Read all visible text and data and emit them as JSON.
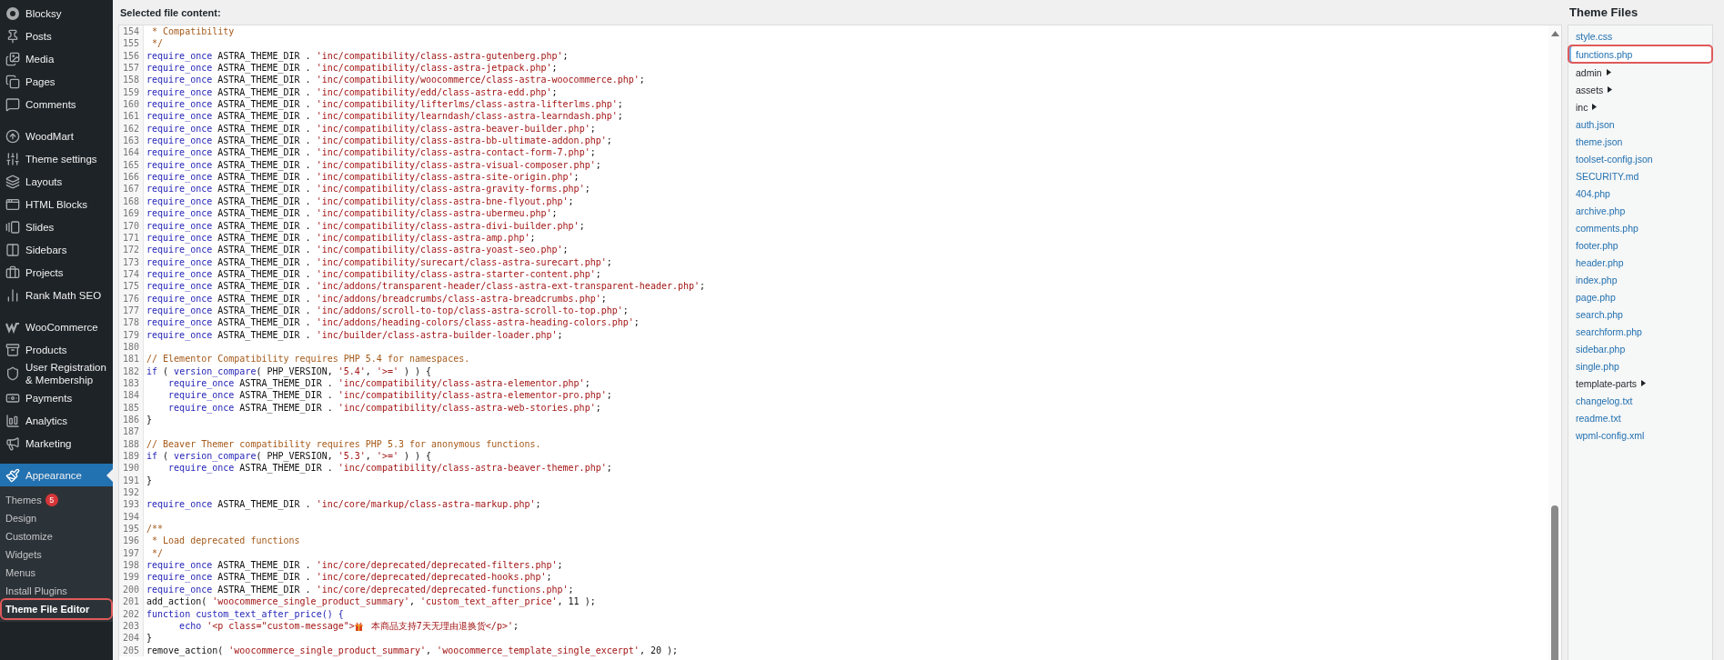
{
  "sidebar": {
    "groups": [
      {
        "items": [
          {
            "label": "Blocksy",
            "selected": false
          },
          {
            "label": "Posts",
            "selected": false
          },
          {
            "label": "Media",
            "selected": false
          },
          {
            "label": "Pages",
            "selected": false
          },
          {
            "label": "Comments",
            "selected": false
          }
        ]
      },
      {
        "items": [
          {
            "label": "WoodMart",
            "selected": false
          },
          {
            "label": "Theme settings",
            "selected": false
          },
          {
            "label": "Layouts",
            "selected": false
          },
          {
            "label": "HTML Blocks",
            "selected": false
          },
          {
            "label": "Slides",
            "selected": false
          },
          {
            "label": "Sidebars",
            "selected": false
          },
          {
            "label": "Projects",
            "selected": false
          },
          {
            "label": "Rank Math SEO",
            "selected": false
          }
        ]
      },
      {
        "items": [
          {
            "label": "WooCommerce",
            "selected": false
          },
          {
            "label": "Products",
            "selected": false
          },
          {
            "label": "User Registration & Membership",
            "selected": false
          },
          {
            "label": "Payments",
            "selected": false
          },
          {
            "label": "Analytics",
            "selected": false
          },
          {
            "label": "Marketing",
            "selected": false
          }
        ]
      },
      {
        "items": [
          {
            "label": "Appearance",
            "selected": true,
            "children": [
              {
                "label": "Themes",
                "badge": "5",
                "selected": false,
                "highlighted": false
              },
              {
                "label": "Design",
                "selected": false,
                "highlighted": false
              },
              {
                "label": "Customize",
                "selected": false,
                "highlighted": false
              },
              {
                "label": "Widgets",
                "selected": false,
                "highlighted": false
              },
              {
                "label": "Menus",
                "selected": false,
                "highlighted": false
              },
              {
                "label": "Install Plugins",
                "selected": false,
                "highlighted": false
              },
              {
                "label": "Theme File Editor",
                "selected": true,
                "highlighted": true
              }
            ]
          }
        ]
      }
    ]
  },
  "editor": {
    "heading": "Selected file content:",
    "lines": [
      {
        "number": "154",
        "tokens": [
          {
            "kind": "comment",
            "text": " * Compatibility"
          }
        ]
      },
      {
        "number": "155",
        "tokens": [
          {
            "kind": "comment",
            "text": " */"
          }
        ]
      },
      {
        "number": "156",
        "tokens": [
          {
            "kind": "keyword",
            "text": "require_once"
          },
          {
            "kind": "plain",
            "text": " ASTRA_THEME_DIR . "
          },
          {
            "kind": "string",
            "text": "'inc/compatibility/class-astra-gutenberg.php'"
          },
          {
            "kind": "plain",
            "text": ";"
          }
        ]
      },
      {
        "number": "157",
        "tokens": [
          {
            "kind": "keyword",
            "text": "require_once"
          },
          {
            "kind": "plain",
            "text": " ASTRA_THEME_DIR . "
          },
          {
            "kind": "string",
            "text": "'inc/compatibility/class-astra-jetpack.php'"
          },
          {
            "kind": "plain",
            "text": ";"
          }
        ]
      },
      {
        "number": "158",
        "tokens": [
          {
            "kind": "keyword",
            "text": "require_once"
          },
          {
            "kind": "plain",
            "text": " ASTRA_THEME_DIR . "
          },
          {
            "kind": "string",
            "text": "'inc/compatibility/woocommerce/class-astra-woocommerce.php'"
          },
          {
            "kind": "plain",
            "text": ";"
          }
        ]
      },
      {
        "number": "159",
        "tokens": [
          {
            "kind": "keyword",
            "text": "require_once"
          },
          {
            "kind": "plain",
            "text": " ASTRA_THEME_DIR . "
          },
          {
            "kind": "string",
            "text": "'inc/compatibility/edd/class-astra-edd.php'"
          },
          {
            "kind": "plain",
            "text": ";"
          }
        ]
      },
      {
        "number": "160",
        "tokens": [
          {
            "kind": "keyword",
            "text": "require_once"
          },
          {
            "kind": "plain",
            "text": " ASTRA_THEME_DIR . "
          },
          {
            "kind": "string",
            "text": "'inc/compatibility/lifterlms/class-astra-lifterlms.php'"
          },
          {
            "kind": "plain",
            "text": ";"
          }
        ]
      },
      {
        "number": "161",
        "tokens": [
          {
            "kind": "keyword",
            "text": "require_once"
          },
          {
            "kind": "plain",
            "text": " ASTRA_THEME_DIR . "
          },
          {
            "kind": "string",
            "text": "'inc/compatibility/learndash/class-astra-learndash.php'"
          },
          {
            "kind": "plain",
            "text": ";"
          }
        ]
      },
      {
        "number": "162",
        "tokens": [
          {
            "kind": "keyword",
            "text": "require_once"
          },
          {
            "kind": "plain",
            "text": " ASTRA_THEME_DIR . "
          },
          {
            "kind": "string",
            "text": "'inc/compatibility/class-astra-beaver-builder.php'"
          },
          {
            "kind": "plain",
            "text": ";"
          }
        ]
      },
      {
        "number": "163",
        "tokens": [
          {
            "kind": "keyword",
            "text": "require_once"
          },
          {
            "kind": "plain",
            "text": " ASTRA_THEME_DIR . "
          },
          {
            "kind": "string",
            "text": "'inc/compatibility/class-astra-bb-ultimate-addon.php'"
          },
          {
            "kind": "plain",
            "text": ";"
          }
        ]
      },
      {
        "number": "164",
        "tokens": [
          {
            "kind": "keyword",
            "text": "require_once"
          },
          {
            "kind": "plain",
            "text": " ASTRA_THEME_DIR . "
          },
          {
            "kind": "string",
            "text": "'inc/compatibility/class-astra-contact-form-7.php'"
          },
          {
            "kind": "plain",
            "text": ";"
          }
        ]
      },
      {
        "number": "165",
        "tokens": [
          {
            "kind": "keyword",
            "text": "require_once"
          },
          {
            "kind": "plain",
            "text": " ASTRA_THEME_DIR . "
          },
          {
            "kind": "string",
            "text": "'inc/compatibility/class-astra-visual-composer.php'"
          },
          {
            "kind": "plain",
            "text": ";"
          }
        ]
      },
      {
        "number": "166",
        "tokens": [
          {
            "kind": "keyword",
            "text": "require_once"
          },
          {
            "kind": "plain",
            "text": " ASTRA_THEME_DIR . "
          },
          {
            "kind": "string",
            "text": "'inc/compatibility/class-astra-site-origin.php'"
          },
          {
            "kind": "plain",
            "text": ";"
          }
        ]
      },
      {
        "number": "167",
        "tokens": [
          {
            "kind": "keyword",
            "text": "require_once"
          },
          {
            "kind": "plain",
            "text": " ASTRA_THEME_DIR . "
          },
          {
            "kind": "string",
            "text": "'inc/compatibility/class-astra-gravity-forms.php'"
          },
          {
            "kind": "plain",
            "text": ";"
          }
        ]
      },
      {
        "number": "168",
        "tokens": [
          {
            "kind": "keyword",
            "text": "require_once"
          },
          {
            "kind": "plain",
            "text": " ASTRA_THEME_DIR . "
          },
          {
            "kind": "string",
            "text": "'inc/compatibility/class-astra-bne-flyout.php'"
          },
          {
            "kind": "plain",
            "text": ";"
          }
        ]
      },
      {
        "number": "169",
        "tokens": [
          {
            "kind": "keyword",
            "text": "require_once"
          },
          {
            "kind": "plain",
            "text": " ASTRA_THEME_DIR . "
          },
          {
            "kind": "string",
            "text": "'inc/compatibility/class-astra-ubermeu.php'"
          },
          {
            "kind": "plain",
            "text": ";"
          }
        ]
      },
      {
        "number": "170",
        "tokens": [
          {
            "kind": "keyword",
            "text": "require_once"
          },
          {
            "kind": "plain",
            "text": " ASTRA_THEME_DIR . "
          },
          {
            "kind": "string",
            "text": "'inc/compatibility/class-astra-divi-builder.php'"
          },
          {
            "kind": "plain",
            "text": ";"
          }
        ]
      },
      {
        "number": "171",
        "tokens": [
          {
            "kind": "keyword",
            "text": "require_once"
          },
          {
            "kind": "plain",
            "text": " ASTRA_THEME_DIR . "
          },
          {
            "kind": "string",
            "text": "'inc/compatibility/class-astra-amp.php'"
          },
          {
            "kind": "plain",
            "text": ";"
          }
        ]
      },
      {
        "number": "172",
        "tokens": [
          {
            "kind": "keyword",
            "text": "require_once"
          },
          {
            "kind": "plain",
            "text": " ASTRA_THEME_DIR . "
          },
          {
            "kind": "string",
            "text": "'inc/compatibility/class-astra-yoast-seo.php'"
          },
          {
            "kind": "plain",
            "text": ";"
          }
        ]
      },
      {
        "number": "173",
        "tokens": [
          {
            "kind": "keyword",
            "text": "require_once"
          },
          {
            "kind": "plain",
            "text": " ASTRA_THEME_DIR . "
          },
          {
            "kind": "string",
            "text": "'inc/compatibility/surecart/class-astra-surecart.php'"
          },
          {
            "kind": "plain",
            "text": ";"
          }
        ]
      },
      {
        "number": "174",
        "tokens": [
          {
            "kind": "keyword",
            "text": "require_once"
          },
          {
            "kind": "plain",
            "text": " ASTRA_THEME_DIR . "
          },
          {
            "kind": "string",
            "text": "'inc/compatibility/class-astra-starter-content.php'"
          },
          {
            "kind": "plain",
            "text": ";"
          }
        ]
      },
      {
        "number": "175",
        "tokens": [
          {
            "kind": "keyword",
            "text": "require_once"
          },
          {
            "kind": "plain",
            "text": " ASTRA_THEME_DIR . "
          },
          {
            "kind": "string",
            "text": "'inc/addons/transparent-header/class-astra-ext-transparent-header.php'"
          },
          {
            "kind": "plain",
            "text": ";"
          }
        ]
      },
      {
        "number": "176",
        "tokens": [
          {
            "kind": "keyword",
            "text": "require_once"
          },
          {
            "kind": "plain",
            "text": " ASTRA_THEME_DIR . "
          },
          {
            "kind": "string",
            "text": "'inc/addons/breadcrumbs/class-astra-breadcrumbs.php'"
          },
          {
            "kind": "plain",
            "text": ";"
          }
        ]
      },
      {
        "number": "177",
        "tokens": [
          {
            "kind": "keyword",
            "text": "require_once"
          },
          {
            "kind": "plain",
            "text": " ASTRA_THEME_DIR . "
          },
          {
            "kind": "string",
            "text": "'inc/addons/scroll-to-top/class-astra-scroll-to-top.php'"
          },
          {
            "kind": "plain",
            "text": ";"
          }
        ]
      },
      {
        "number": "178",
        "tokens": [
          {
            "kind": "keyword",
            "text": "require_once"
          },
          {
            "kind": "plain",
            "text": " ASTRA_THEME_DIR . "
          },
          {
            "kind": "string",
            "text": "'inc/addons/heading-colors/class-astra-heading-colors.php'"
          },
          {
            "kind": "plain",
            "text": ";"
          }
        ]
      },
      {
        "number": "179",
        "tokens": [
          {
            "kind": "keyword",
            "text": "require_once"
          },
          {
            "kind": "plain",
            "text": " ASTRA_THEME_DIR . "
          },
          {
            "kind": "string",
            "text": "'inc/builder/class-astra-builder-loader.php'"
          },
          {
            "kind": "plain",
            "text": ";"
          }
        ]
      },
      {
        "number": "180"
      },
      {
        "number": "181",
        "tokens": [
          {
            "kind": "comment",
            "text": "// Elementor Compatibility requires PHP 5.4 for namespaces."
          }
        ]
      },
      {
        "number": "182",
        "tokens": [
          {
            "kind": "keyword",
            "text": "if"
          },
          {
            "kind": "plain",
            "text": " ( "
          },
          {
            "kind": "keyword",
            "text": "version_compare"
          },
          {
            "kind": "plain",
            "text": "( PHP_VERSION, "
          },
          {
            "kind": "string",
            "text": "'5.4'"
          },
          {
            "kind": "plain",
            "text": ", "
          },
          {
            "kind": "string",
            "text": "'>='"
          },
          {
            "kind": "plain",
            "text": " ) ) {"
          }
        ]
      },
      {
        "number": "183",
        "tokens": [
          {
            "kind": "keyword",
            "text": "    require_once"
          },
          {
            "kind": "plain",
            "text": " ASTRA_THEME_DIR . "
          },
          {
            "kind": "string",
            "text": "'inc/compatibility/class-astra-elementor.php'"
          },
          {
            "kind": "plain",
            "text": ";"
          }
        ]
      },
      {
        "number": "184",
        "tokens": [
          {
            "kind": "keyword",
            "text": "    require_once"
          },
          {
            "kind": "plain",
            "text": " ASTRA_THEME_DIR . "
          },
          {
            "kind": "string",
            "text": "'inc/compatibility/class-astra-elementor-pro.php'"
          },
          {
            "kind": "plain",
            "text": ";"
          }
        ]
      },
      {
        "number": "185",
        "tokens": [
          {
            "kind": "keyword",
            "text": "    require_once"
          },
          {
            "kind": "plain",
            "text": " ASTRA_THEME_DIR . "
          },
          {
            "kind": "string",
            "text": "'inc/compatibility/class-astra-web-stories.php'"
          },
          {
            "kind": "plain",
            "text": ";"
          }
        ]
      },
      {
        "number": "186",
        "tokens": [
          {
            "kind": "plain",
            "text": "}"
          }
        ]
      },
      {
        "number": "187"
      },
      {
        "number": "188",
        "tokens": [
          {
            "kind": "comment",
            "text": "// Beaver Themer compatibility requires PHP 5.3 for anonymous functions."
          }
        ]
      },
      {
        "number": "189",
        "tokens": [
          {
            "kind": "keyword",
            "text": "if"
          },
          {
            "kind": "plain",
            "text": " ( "
          },
          {
            "kind": "keyword",
            "text": "version_compare"
          },
          {
            "kind": "plain",
            "text": "( PHP_VERSION, "
          },
          {
            "kind": "string",
            "text": "'5.3'"
          },
          {
            "kind": "plain",
            "text": ", "
          },
          {
            "kind": "string",
            "text": "'>='"
          },
          {
            "kind": "plain",
            "text": " ) ) {"
          }
        ]
      },
      {
        "number": "190",
        "tokens": [
          {
            "kind": "keyword",
            "text": "    require_once"
          },
          {
            "kind": "plain",
            "text": " ASTRA_THEME_DIR . "
          },
          {
            "kind": "string",
            "text": "'inc/compatibility/class-astra-beaver-themer.php'"
          },
          {
            "kind": "plain",
            "text": ";"
          }
        ]
      },
      {
        "number": "191",
        "tokens": [
          {
            "kind": "plain",
            "text": "}"
          }
        ]
      },
      {
        "number": "192"
      },
      {
        "number": "193",
        "tokens": [
          {
            "kind": "keyword",
            "text": "require_once"
          },
          {
            "kind": "plain",
            "text": " ASTRA_THEME_DIR . "
          },
          {
            "kind": "string",
            "text": "'inc/core/markup/class-astra-markup.php'"
          },
          {
            "kind": "plain",
            "text": ";"
          }
        ]
      },
      {
        "number": "194"
      },
      {
        "number": "195",
        "tokens": [
          {
            "kind": "comment",
            "text": "/**"
          }
        ]
      },
      {
        "number": "196",
        "tokens": [
          {
            "kind": "comment",
            "text": " * Load deprecated functions"
          }
        ]
      },
      {
        "number": "197",
        "tokens": [
          {
            "kind": "comment",
            "text": " */"
          }
        ]
      },
      {
        "number": "198",
        "tokens": [
          {
            "kind": "keyword",
            "text": "require_once"
          },
          {
            "kind": "plain",
            "text": " ASTRA_THEME_DIR . "
          },
          {
            "kind": "string",
            "text": "'inc/core/deprecated/deprecated-filters.php'"
          },
          {
            "kind": "plain",
            "text": ";"
          }
        ]
      },
      {
        "number": "199",
        "tokens": [
          {
            "kind": "keyword",
            "text": "require_once"
          },
          {
            "kind": "plain",
            "text": " ASTRA_THEME_DIR . "
          },
          {
            "kind": "string",
            "text": "'inc/core/deprecated/deprecated-hooks.php'"
          },
          {
            "kind": "plain",
            "text": ";"
          }
        ]
      },
      {
        "number": "200",
        "tokens": [
          {
            "kind": "keyword",
            "text": "require_once"
          },
          {
            "kind": "plain",
            "text": " ASTRA_THEME_DIR . "
          },
          {
            "kind": "string",
            "text": "'inc/core/deprecated/deprecated-functions.php'"
          },
          {
            "kind": "plain",
            "text": ";"
          }
        ]
      },
      {
        "number": "201",
        "tokens": [
          {
            "kind": "plain",
            "text": "add_action( "
          },
          {
            "kind": "string",
            "text": "'woocommerce_single_product_summary'"
          },
          {
            "kind": "plain",
            "text": ", "
          },
          {
            "kind": "string",
            "text": "'custom_text_after_price'"
          },
          {
            "kind": "plain",
            "text": ", 11 );"
          }
        ]
      },
      {
        "number": "202",
        "tokens": [
          {
            "kind": "keyword",
            "text": "function custom_text_after_price() {"
          }
        ]
      },
      {
        "number": "203",
        "tokens": [
          {
            "kind": "keyword",
            "text": "      echo "
          },
          {
            "kind": "string",
            "text": "'<p class=\"custom-message\">"
          },
          {
            "kind": "gift"
          },
          {
            "kind": "string",
            "text": " 本商品支持7天无理由退换货</p>'"
          },
          {
            "kind": "plain",
            "text": ";"
          }
        ]
      },
      {
        "number": "204",
        "tokens": [
          {
            "kind": "plain",
            "text": "}"
          }
        ]
      },
      {
        "number": "205",
        "tokens": [
          {
            "kind": "plain",
            "text": "remove_action( "
          },
          {
            "kind": "string",
            "text": "'woocommerce_single_product_summary'"
          },
          {
            "kind": "plain",
            "text": ", "
          },
          {
            "kind": "string",
            "text": "'woocommerce_template_single_excerpt'"
          },
          {
            "kind": "plain",
            "text": ", 20 );"
          }
        ]
      }
    ]
  },
  "theme_files": {
    "title": "Theme Files",
    "items": [
      {
        "label": "style.css",
        "kind": "file",
        "selected": false,
        "highlighted": false
      },
      {
        "label": "functions.php",
        "kind": "file",
        "selected": true,
        "highlighted": true
      },
      {
        "label": "admin",
        "kind": "folder",
        "selected": false,
        "highlighted": false
      },
      {
        "label": "assets",
        "kind": "folder",
        "selected": false,
        "highlighted": false
      },
      {
        "label": "inc",
        "kind": "folder",
        "selected": false,
        "highlighted": false
      },
      {
        "label": "auth.json",
        "kind": "file",
        "selected": false,
        "highlighted": false
      },
      {
        "label": "theme.json",
        "kind": "file",
        "selected": false,
        "highlighted": false
      },
      {
        "label": "toolset-config.json",
        "kind": "file",
        "selected": false,
        "highlighted": false
      },
      {
        "label": "SECURITY.md",
        "kind": "file",
        "selected": false,
        "highlighted": false
      },
      {
        "label": "404.php",
        "kind": "file",
        "selected": false,
        "highlighted": false
      },
      {
        "label": "archive.php",
        "kind": "file",
        "selected": false,
        "highlighted": false
      },
      {
        "label": "comments.php",
        "kind": "file",
        "selected": false,
        "highlighted": false
      },
      {
        "label": "footer.php",
        "kind": "file",
        "selected": false,
        "highlighted": false
      },
      {
        "label": "header.php",
        "kind": "file",
        "selected": false,
        "highlighted": false
      },
      {
        "label": "index.php",
        "kind": "file",
        "selected": false,
        "highlighted": false
      },
      {
        "label": "page.php",
        "kind": "file",
        "selected": false,
        "highlighted": false
      },
      {
        "label": "search.php",
        "kind": "file",
        "selected": false,
        "highlighted": false
      },
      {
        "label": "searchform.php",
        "kind": "file",
        "selected": false,
        "highlighted": false
      },
      {
        "label": "sidebar.php",
        "kind": "file",
        "selected": false,
        "highlighted": false
      },
      {
        "label": "single.php",
        "kind": "file",
        "selected": false,
        "highlighted": false
      },
      {
        "label": "template-parts",
        "kind": "folder",
        "selected": false,
        "highlighted": false
      },
      {
        "label": "changelog.txt",
        "kind": "file",
        "selected": false,
        "highlighted": false
      },
      {
        "label": "readme.txt",
        "kind": "file",
        "selected": false,
        "highlighted": false
      },
      {
        "label": "wpml-config.xml",
        "kind": "file",
        "selected": false,
        "highlighted": false
      }
    ]
  }
}
